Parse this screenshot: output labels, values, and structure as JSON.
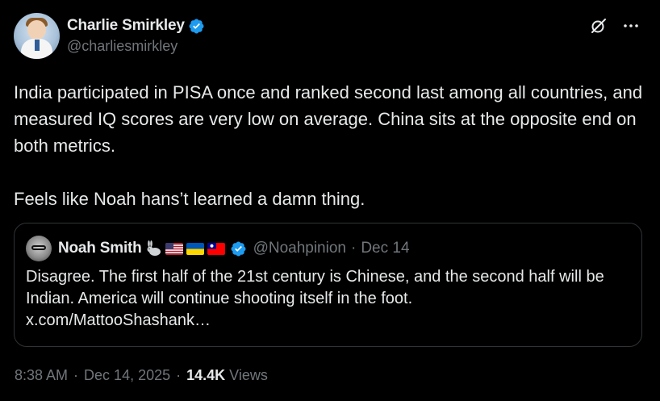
{
  "author": {
    "display_name": "Charlie Smirkley",
    "handle": "@charliesmirkley",
    "verified": true,
    "avatar_icon": "cartoon-avatar"
  },
  "top_icons": [
    "grok-icon",
    "more-icon"
  ],
  "tweet": {
    "text": "India participated in PISA once and ranked second last among all countries, and measured IQ scores are very low on average. China sits at the opposite end on both metrics.\n\nFeels like Noah hans’t learned a damn thing."
  },
  "quote": {
    "display_name": "Noah Smith",
    "emojis": [
      "rabbit-icon",
      "us-flag-icon",
      "ukraine-flag-icon",
      "taiwan-flag-icon"
    ],
    "verified": true,
    "handle": "@Noahpinion",
    "separator": "·",
    "date": "Dec 14",
    "text": "Disagree. The first half of the 21st century is Chinese, and the second half will be Indian. America will continue shooting itself in the foot.\nx.com/MattooShashank…"
  },
  "meta": {
    "time": "8:38 AM",
    "separator": "·",
    "date": "Dec 14, 2025",
    "views_count": "14.4K",
    "views_label": "Views"
  },
  "colors": {
    "background": "#000000",
    "text": "#e7e9ea",
    "secondary": "#71767b",
    "verified": "#1d9bf0",
    "border": "#2f3336"
  }
}
